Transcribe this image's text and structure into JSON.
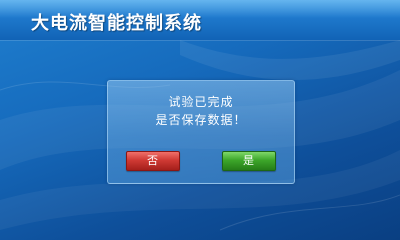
{
  "window": {
    "title": "大电流智能控制系统"
  },
  "dialog": {
    "message_line1": "试验已完成",
    "message_line2": "是否保存数据！",
    "no_label": "否",
    "yes_label": "是"
  },
  "colors": {
    "background": "#166bbd",
    "title_bar": "#1e78cc",
    "no_button": "#d03a34",
    "yes_button": "#3da72a",
    "text": "#ffffff"
  }
}
